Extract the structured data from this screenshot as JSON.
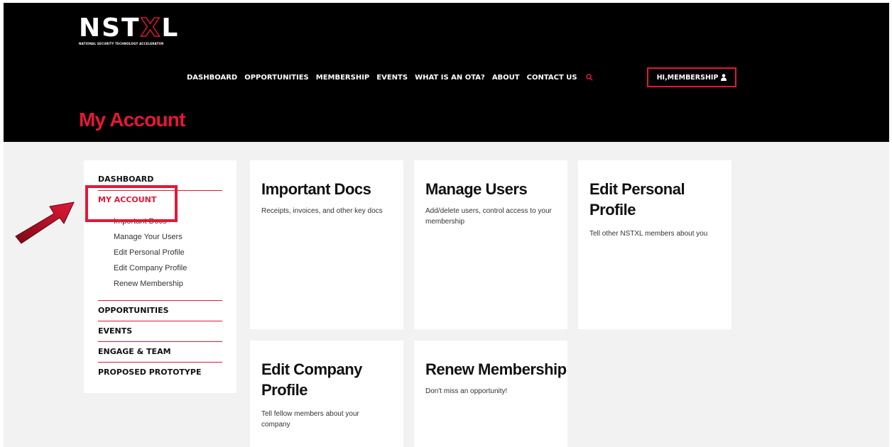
{
  "brand": {
    "logo_prefix": "NST",
    "logo_x": "X",
    "logo_suffix": "L",
    "tagline": "NATIONAL SECURITY TECHNOLOGY ACCELERATOR",
    "accent_color": "#e31837"
  },
  "nav": {
    "items": [
      "DASHBOARD",
      "OPPORTUNITIES",
      "MEMBERSHIP",
      "EVENTS",
      "WHAT IS AN OTA?",
      "ABOUT",
      "CONTACT US"
    ],
    "search_icon": "search-icon",
    "user_label": "HI,MEMBERSHIP",
    "user_icon": "user-icon"
  },
  "page": {
    "title": "My Account"
  },
  "sidebar": {
    "dashboard": "DASHBOARD",
    "my_account": "MY ACCOUNT",
    "sub_items": [
      "Important Docs",
      "Manage Your Users",
      "Edit Personal Profile",
      "Edit Company Profile",
      "Renew Membership"
    ],
    "sections": [
      "OPPORTUNITIES",
      "EVENTS",
      "ENGAGE & TEAM",
      "PROPOSED PROTOTYPE"
    ]
  },
  "cards": [
    {
      "title": "Important Docs",
      "desc": "Receipts, invoices, and other key docs"
    },
    {
      "title": "Manage Users",
      "desc": "Add/delete users, control access to your membership"
    },
    {
      "title": "Edit Personal Profile",
      "desc": "Tell other NSTXL members about you"
    },
    {
      "title": "Edit Company Profile",
      "desc": "Tell fellow members about your company"
    },
    {
      "title": "Renew Membership",
      "desc": "Don't miss an opportunity!"
    }
  ],
  "annotation": {
    "arrow_icon": "arrow-icon",
    "highlight_color": "#e31837"
  }
}
